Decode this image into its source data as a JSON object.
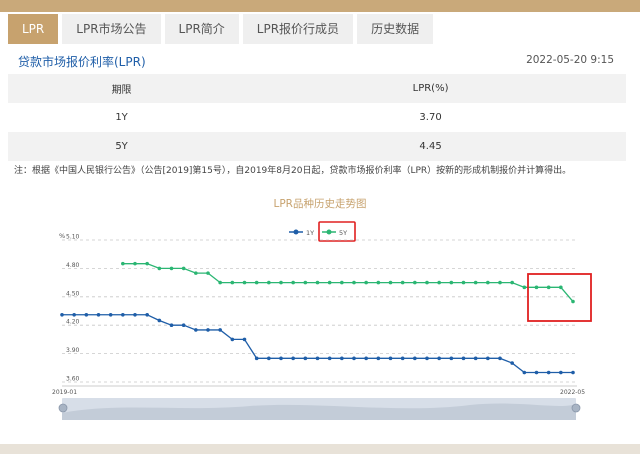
{
  "tabs": [
    {
      "label": "LPR",
      "active": true
    },
    {
      "label": "LPR市场公告",
      "active": false
    },
    {
      "label": "LPR简介",
      "active": false
    },
    {
      "label": "LPR报价行成员",
      "active": false
    },
    {
      "label": "历史数据",
      "active": false
    }
  ],
  "card": {
    "title": "贷款市场报价利率(LPR)",
    "timestamp": "2022-05-20 9:15"
  },
  "rates_table": {
    "headers": [
      "期限",
      "LPR(%)"
    ],
    "rows": [
      {
        "term": "1Y",
        "rate": "3.70"
      },
      {
        "term": "5Y",
        "rate": "4.45"
      }
    ]
  },
  "note": "注：根据《中国人民银行公告》（公告[2019]第15号），自2019年8月20日起，贷款市场报价利率（LPR）按新的形成机制报价并计算得出。",
  "colors": {
    "accent": "#c7a26e",
    "series_1y": "#1f5ea8",
    "series_5y": "#2bb673",
    "highlight_box": "#e02020"
  },
  "chart_data": {
    "type": "line",
    "title": "LPR品种历史走势图",
    "ylabel": "%",
    "ylim": [
      3.6,
      5.1
    ],
    "y_ticks": [
      "5.10",
      "4.80",
      "4.50",
      "4.20",
      "3.90",
      "3.60"
    ],
    "x_start_label": "2019-01",
    "x_end_label": "2022-05",
    "legend_position": "top-center",
    "grid": true,
    "series": [
      {
        "name": "1Y",
        "values": [
          4.31,
          4.31,
          4.31,
          4.31,
          4.31,
          4.31,
          4.31,
          4.31,
          4.25,
          4.2,
          4.2,
          4.15,
          4.15,
          4.15,
          4.05,
          4.05,
          3.85,
          3.85,
          3.85,
          3.85,
          3.85,
          3.85,
          3.85,
          3.85,
          3.85,
          3.85,
          3.85,
          3.85,
          3.85,
          3.85,
          3.85,
          3.85,
          3.85,
          3.85,
          3.85,
          3.85,
          3.85,
          3.8,
          3.7,
          3.7,
          3.7,
          3.7,
          3.7
        ]
      },
      {
        "name": "5Y",
        "values": [
          null,
          null,
          null,
          null,
          null,
          4.85,
          4.85,
          4.85,
          4.8,
          4.8,
          4.8,
          4.75,
          4.75,
          4.65,
          4.65,
          4.65,
          4.65,
          4.65,
          4.65,
          4.65,
          4.65,
          4.65,
          4.65,
          4.65,
          4.65,
          4.65,
          4.65,
          4.65,
          4.65,
          4.65,
          4.65,
          4.65,
          4.65,
          4.65,
          4.65,
          4.65,
          4.65,
          4.65,
          4.6,
          4.6,
          4.6,
          4.6,
          4.45
        ]
      }
    ]
  }
}
